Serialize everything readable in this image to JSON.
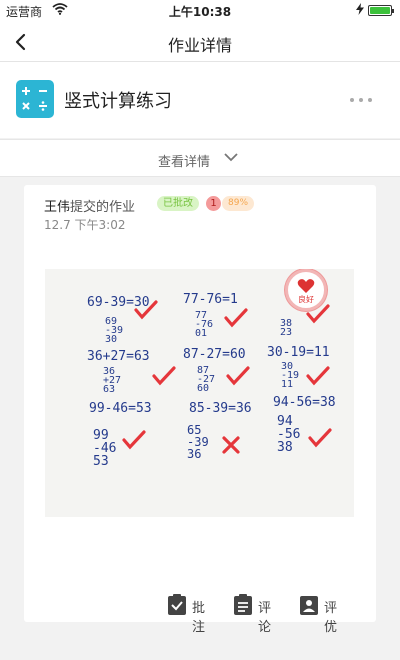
{
  "status": {
    "carrier": "运营商",
    "time": "上午10:38",
    "battery_level": 1.0
  },
  "nav": {
    "title": "作业详情"
  },
  "task": {
    "name": "竖式计算练习"
  },
  "details_toggle": {
    "label": "查看详情"
  },
  "submission": {
    "student_name": "王伟",
    "submitted_label": "提交的作业",
    "graded_tag": "已批改",
    "error_count": "1",
    "score_tag": "89%",
    "date": "12.7 下午3:02"
  },
  "photo": {
    "stamp_text": "良好",
    "equations": [
      "69-39=30",
      "77-76=1",
      "36+27=63",
      "87-27=60",
      "30-19=11",
      "99-46=53",
      "85-39=36",
      "94-56=38"
    ],
    "work": [
      "69",
      "-39",
      "30",
      "77",
      "-76",
      "01",
      "38",
      "23",
      "36",
      "+27",
      "63",
      "87",
      "-27",
      "60",
      "30",
      "-19",
      "11",
      "99",
      "-46",
      "53",
      "65",
      "-39",
      "36",
      "94",
      "-56",
      "38"
    ]
  },
  "actions": {
    "annotate": "批注",
    "comment": "评论",
    "commend": "评优"
  },
  "colors": {
    "accent": "#2cb5d4",
    "check_red": "#e5363b",
    "ink_blue": "#243a8c"
  }
}
